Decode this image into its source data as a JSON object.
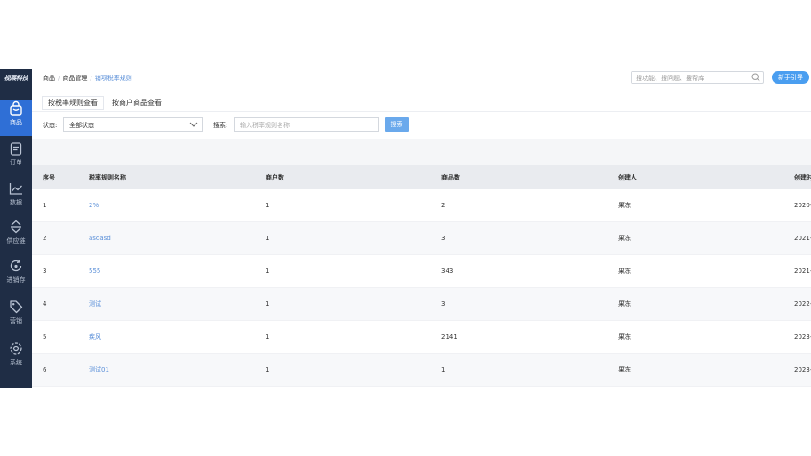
{
  "logo": "视展科技",
  "sidebar": {
    "items": [
      {
        "label": "商品",
        "icon": "shopping-bag-icon"
      },
      {
        "label": "订单",
        "icon": "order-doc-icon"
      },
      {
        "label": "数据",
        "icon": "line-chart-icon"
      },
      {
        "label": "供应链",
        "icon": "swap-arrows-icon"
      },
      {
        "label": "进销存",
        "icon": "refresh-box-icon"
      },
      {
        "label": "营销",
        "icon": "tag-icon"
      },
      {
        "label": "系统",
        "icon": "gear-icon"
      }
    ]
  },
  "breadcrumb": {
    "items": [
      "商品",
      "商品管理",
      "销项税率规则"
    ]
  },
  "search": {
    "placeholder": "搜功能、搜问题、搜帮库"
  },
  "guide_button": "新手引导",
  "tabs": [
    {
      "label": "按税率规则查看"
    },
    {
      "label": "按商户商品查看"
    }
  ],
  "filters": {
    "status_label": "状态:",
    "status_value": "全部状态",
    "keyword_label": "搜索:",
    "keyword_placeholder": "输入税率规则名称",
    "search_button": "搜索"
  },
  "table": {
    "headers": [
      "序号",
      "税率规则名称",
      "商户数",
      "商品数",
      "创建人",
      "创建时间"
    ],
    "rows": [
      [
        "1",
        "2%",
        "1",
        "2",
        "果冻",
        "2020-"
      ],
      [
        "2",
        "asdasd",
        "1",
        "3",
        "果冻",
        "2021-"
      ],
      [
        "3",
        "555",
        "1",
        "343",
        "果冻",
        "2021-"
      ],
      [
        "4",
        "测试",
        "1",
        "3",
        "果冻",
        "2022-"
      ],
      [
        "5",
        "疾风",
        "1",
        "2141",
        "果冻",
        "2023-"
      ],
      [
        "6",
        "测试01",
        "1",
        "1",
        "果冻",
        "2023-"
      ]
    ]
  },
  "colors": {
    "sidebar": "#1f2d45",
    "active_nav": "#2f6fd6",
    "link": "#5a8fd8",
    "accent_button": "#4a9ef0"
  }
}
